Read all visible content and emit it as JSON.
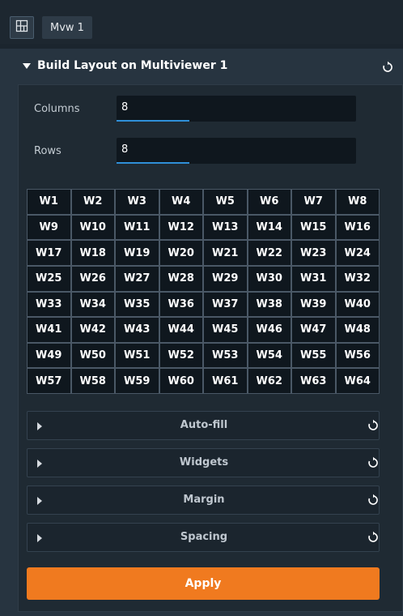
{
  "tabs": {
    "layout_icon": "grid-layout-icon",
    "active_tab": "Mvw 1"
  },
  "panel": {
    "title": "Build Layout on Multiviewer 1",
    "columns_label": "Columns",
    "columns_value": "8",
    "rows_label": "Rows",
    "rows_value": "8"
  },
  "grid": {
    "cells": [
      "W1",
      "W2",
      "W3",
      "W4",
      "W5",
      "W6",
      "W7",
      "W8",
      "W9",
      "W10",
      "W11",
      "W12",
      "W13",
      "W14",
      "W15",
      "W16",
      "W17",
      "W18",
      "W19",
      "W20",
      "W21",
      "W22",
      "W23",
      "W24",
      "W25",
      "W26",
      "W27",
      "W28",
      "W29",
      "W30",
      "W31",
      "W32",
      "W33",
      "W34",
      "W35",
      "W36",
      "W37",
      "W38",
      "W39",
      "W40",
      "W41",
      "W42",
      "W43",
      "W44",
      "W45",
      "W46",
      "W47",
      "W48",
      "W49",
      "W50",
      "W51",
      "W52",
      "W53",
      "W54",
      "W55",
      "W56",
      "W57",
      "W58",
      "W59",
      "W60",
      "W61",
      "W62",
      "W63",
      "W64"
    ]
  },
  "sections": [
    "Auto-fill",
    "Widgets",
    "Margin",
    "Spacing"
  ],
  "apply_label": "Apply",
  "colors": {
    "accent": "#f07a1f",
    "input_underline": "#2f8fd8"
  }
}
